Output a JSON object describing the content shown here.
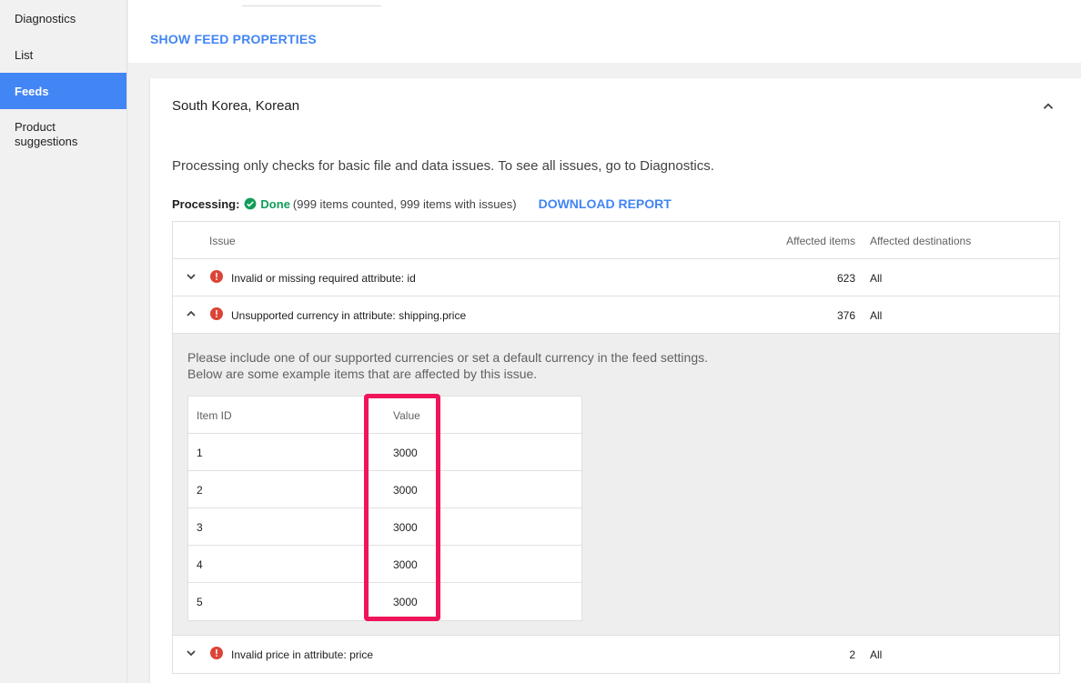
{
  "sidebar": {
    "items": [
      {
        "label": "Diagnostics",
        "active": false
      },
      {
        "label": "List",
        "active": false
      },
      {
        "label": "Feeds",
        "active": true
      },
      {
        "label": "Product suggestions",
        "active": false
      }
    ]
  },
  "main": {
    "show_feed_properties": "SHOW FEED PROPERTIES",
    "card": {
      "title": "South Korea, Korean",
      "info": "Processing only checks for basic file and data issues. To see all issues, go to Diagnostics.",
      "processing": {
        "label": "Processing:",
        "status": "Done",
        "detail": "(999 items counted, 999 items with issues)",
        "download": "DOWNLOAD REPORT"
      },
      "table": {
        "headers": {
          "issue": "Issue",
          "affected": "Affected items",
          "destinations": "Affected destinations"
        },
        "rows": [
          {
            "issue": "Invalid or missing required attribute: id",
            "affected": "623",
            "destinations": "All",
            "expanded": false
          },
          {
            "issue": "Unsupported currency in attribute: shipping.price",
            "affected": "376",
            "destinations": "All",
            "expanded": true
          },
          {
            "issue": "Invalid price in attribute: price",
            "affected": "2",
            "destinations": "All",
            "expanded": false
          }
        ],
        "detail": {
          "message_line1": "Please include one of our supported currencies or set a default currency in the feed settings.",
          "message_line2": "Below are some example items that are affected by this issue.",
          "headers": {
            "item_id": "Item ID",
            "value": "Value"
          },
          "items": [
            {
              "id": "1",
              "value": "3000"
            },
            {
              "id": "2",
              "value": "3000"
            },
            {
              "id": "3",
              "value": "3000"
            },
            {
              "id": "4",
              "value": "3000"
            },
            {
              "id": "5",
              "value": "3000"
            }
          ]
        }
      }
    }
  },
  "colors": {
    "accent": "#4285f4",
    "success": "#0f9d58",
    "error": "#db4437",
    "highlight": "#f0145a"
  }
}
